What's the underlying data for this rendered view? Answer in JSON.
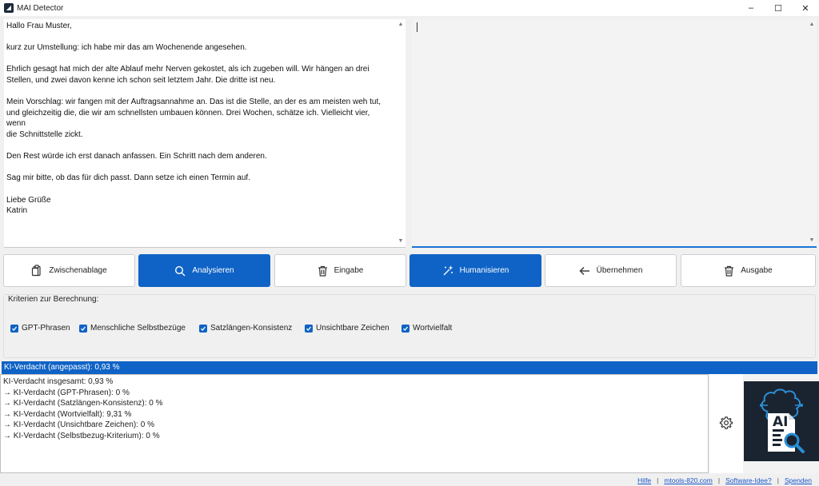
{
  "window": {
    "title": "MAI Detector",
    "controls": [
      "–",
      "☐",
      "✕"
    ]
  },
  "input_text": {
    "paragraphs": [
      [
        "Hallo Frau Muster,"
      ],
      [
        "kurz zur Umstellung: ich habe mir das am Wochenende angesehen."
      ],
      [
        "Ehrlich gesagt hat mich der alte Ablauf mehr Nerven gekostet, als ich zugeben will. Wir hängen an drei",
        "Stellen, und zwei davon kenne ich schon seit letztem Jahr. Die dritte ist neu."
      ],
      [
        "Mein Vorschlag: wir fangen mit der Auftragsannahme an. Das ist die Stelle, an der es am meisten weh tut,",
        "und gleichzeitig die, die wir am schnellsten umbauen können. Drei Wochen, schätze ich. Vielleicht vier, wenn",
        "die Schnittstelle zickt."
      ],
      [
        "Den Rest würde ich erst danach anfassen. Ein Schritt nach dem anderen."
      ],
      [
        "Sag mir bitte, ob das für dich passt. Dann setze ich einen Termin auf."
      ],
      [
        "Liebe Grüße",
        "Katrin"
      ]
    ]
  },
  "output_text": "",
  "buttons": [
    {
      "label": "Zwischenablage",
      "icon": "clipboard-icon",
      "primary": false
    },
    {
      "label": "Analysieren",
      "icon": "search-icon",
      "primary": true
    },
    {
      "label": "Eingabe",
      "icon": "trash-icon",
      "primary": false
    },
    {
      "label": "Humanisieren",
      "icon": "magic-wand-icon",
      "primary": true
    },
    {
      "label": "Übernehmen",
      "icon": "arrow-left-icon",
      "primary": false
    },
    {
      "label": "Ausgabe",
      "icon": "trash-icon",
      "primary": false
    }
  ],
  "criteria": {
    "label": "Kriterien zur Berechnung:",
    "items": [
      {
        "label": "GPT-Phrasen",
        "checked": true
      },
      {
        "label": "Menschliche Selbstbezüge",
        "checked": true
      },
      {
        "label": "Satzlängen-Konsistenz",
        "checked": true
      },
      {
        "label": "Unsichtbare Zeichen",
        "checked": true
      },
      {
        "label": "Wortvielfalt",
        "checked": true
      }
    ]
  },
  "result": {
    "header": "KI-Verdacht (angepasst): 0,93 %",
    "lines": [
      "KI-Verdacht insgesamt: 0,93 %",
      "→ KI-Verdacht (GPT-Phrasen): 0 %",
      "→ KI-Verdacht (Satzlängen-Konsistenz): 0 %",
      "→ KI-Verdacht (Wortvielfalt): 9,31 %",
      "→ KI-Verdacht (Unsichtbare Zeichen): 0 %",
      "→ KI-Verdacht (Selbstbezug-Kriterium): 0 %"
    ]
  },
  "logo": {
    "text": "AI",
    "icon": "ai-document-logo-icon"
  },
  "footer_links": [
    "Hilfe",
    "mtools-820.com",
    "Software-Idee?",
    "Spenden"
  ],
  "colors": {
    "accent": "#0f63c6",
    "logo_bg": "#1a2431",
    "link": "#1a56c8"
  }
}
